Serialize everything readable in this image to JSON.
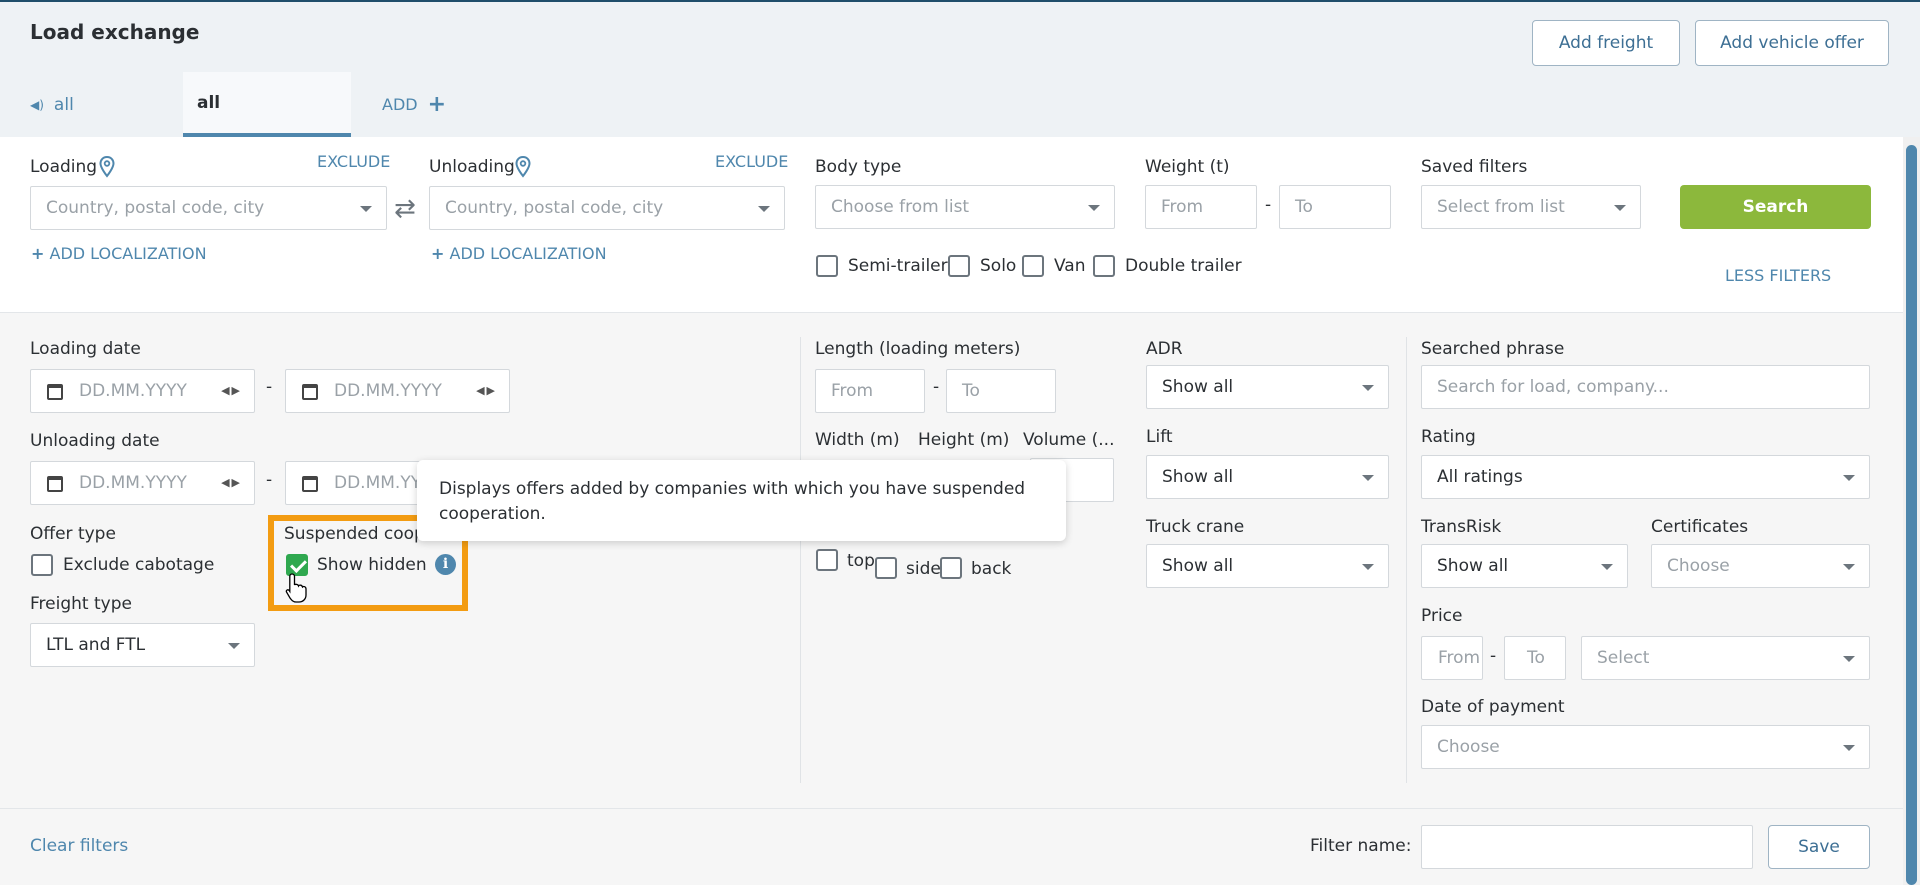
{
  "header": {
    "title": "Load exchange",
    "add_freight": "Add freight",
    "add_vehicle_offer": "Add vehicle offer"
  },
  "tabs": [
    {
      "label": "all",
      "icon": "speaker-icon"
    },
    {
      "label": "all"
    },
    {
      "label": "ADD",
      "icon": "plus-icon"
    }
  ],
  "basic_filters": {
    "loading_label": "Loading",
    "unloading_label": "Unloading",
    "exclude": "EXCLUDE",
    "location_placeholder": "Country, postal code, city",
    "add_localization": "ADD LOCALIZATION",
    "body_type_label": "Body type",
    "body_type_placeholder": "Choose from list",
    "weight_label": "Weight (t)",
    "from": "From",
    "to": "To",
    "dash": "-",
    "saved_filters_label": "Saved filters",
    "saved_filters_placeholder": "Select from list",
    "search": "Search",
    "less_filters": "LESS FILTERS",
    "body_checkboxes": [
      "Semi-trailer",
      "Solo",
      "Van",
      "Double trailer"
    ]
  },
  "advanced": {
    "loading_date_label": "Loading date",
    "unloading_date_label": "Unloading date",
    "date_placeholder": "DD.MM.YYYY",
    "date_placeholder_cut": "DD.MM.YY",
    "offer_type_label": "Offer type",
    "exclude_cabotage": "Exclude cabotage",
    "suspended_label": "Suspended coop",
    "show_hidden": "Show hidden",
    "freight_type_label": "Freight type",
    "freight_type_value": "LTL and FTL",
    "length_label": "Length (loading meters)",
    "width_label": "Width (m)",
    "height_label": "Height (m)",
    "volume_label": "Volume (...",
    "loading_sides": [
      "top",
      "side",
      "back"
    ],
    "adr_label": "ADR",
    "lift_label": "Lift",
    "truck_crane_label": "Truck crane",
    "show_all": "Show all",
    "searched_phrase_label": "Searched phrase",
    "searched_phrase_placeholder": "Search for load, company...",
    "rating_label": "Rating",
    "rating_value": "All ratings",
    "transrisk_label": "TransRisk",
    "certificates_label": "Certificates",
    "choose": "Choose",
    "price_label": "Price",
    "select": "Select",
    "date_of_payment_label": "Date of payment"
  },
  "tooltip": {
    "text": "Displays offers added by companies with which you have suspended cooperation."
  },
  "footer": {
    "clear_filters": "Clear filters",
    "filter_name_label": "Filter name:",
    "save": "Save"
  },
  "colors": {
    "accent": "#4f87ad",
    "search_green": "#8cb83c",
    "checkbox_green": "#2fa84f",
    "highlight_orange": "#f39c12"
  }
}
